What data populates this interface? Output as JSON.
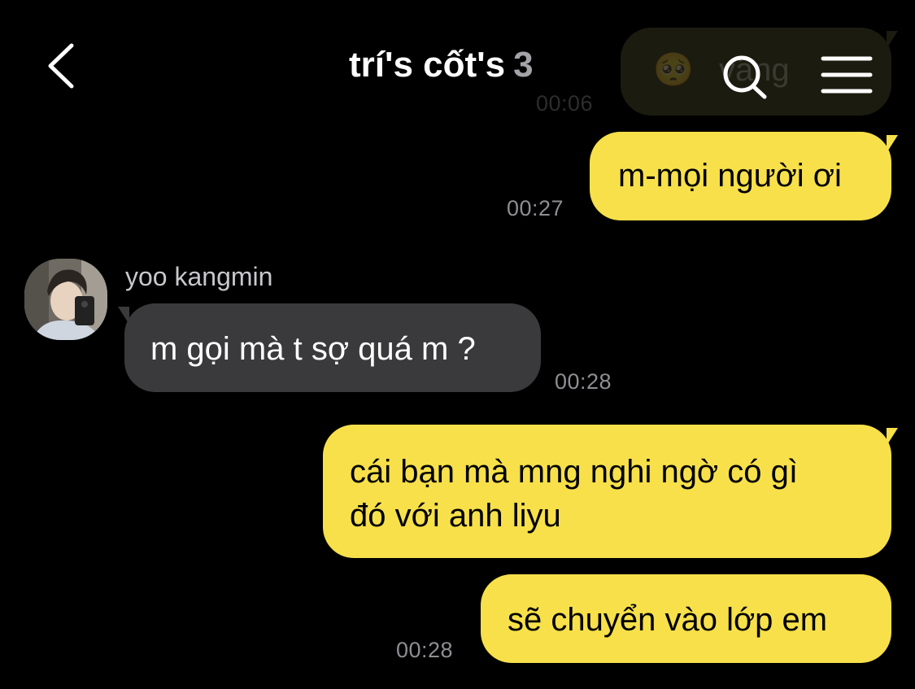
{
  "header": {
    "title": "trí's cốt's",
    "member_count": "3",
    "back_icon": "chevron-left-icon",
    "search_icon": "search-icon",
    "menu_icon": "menu-icon"
  },
  "messages": [
    {
      "sender": "self",
      "text": "vâng",
      "time": "00:06",
      "faded": true,
      "emoji": "🥺"
    },
    {
      "sender": "self",
      "text": "m-mọi người ơi",
      "time": "00:27"
    },
    {
      "sender": "yoo kangmin",
      "text": "m gọi mà t sợ quá m ?",
      "time": "00:28"
    },
    {
      "sender": "self",
      "text_line1": "cái bạn mà mng nghi ngờ có gì",
      "text_line2": "đó với anh liyu"
    },
    {
      "sender": "self",
      "text": "sẽ chuyển vào lớp em",
      "time": "00:28"
    }
  ],
  "colors": {
    "background": "#000000",
    "my_bubble": "#f7e04a",
    "their_bubble": "#3a3a3c",
    "timestamp": "#8e8e93"
  }
}
